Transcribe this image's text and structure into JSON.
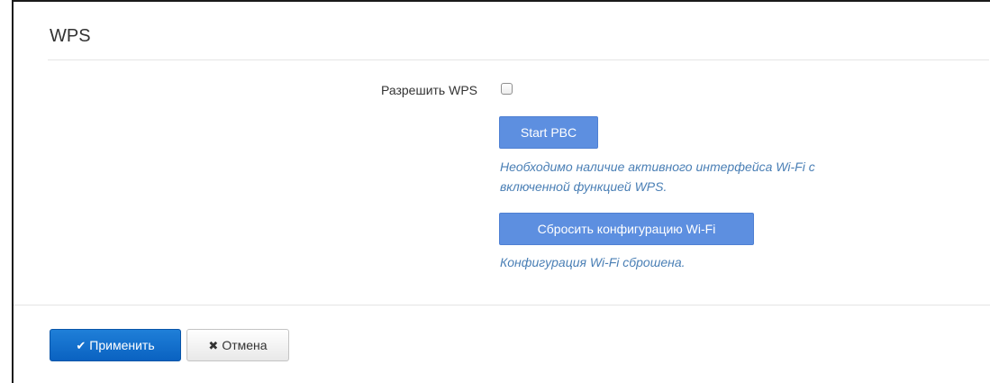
{
  "section": {
    "title": "WPS"
  },
  "wps_enable": {
    "label": "Разрешить WPS",
    "checked": false
  },
  "pbc": {
    "button_label": "Start PBC",
    "help_line1": "Необходимо наличие активного интерфейса Wi-Fi с",
    "help_line2": "включенной функцией WPS."
  },
  "reset": {
    "button_label": "Сбросить конфигурацию Wi-Fi",
    "status": "Конфигурация Wi-Fi сброшена."
  },
  "footer": {
    "apply_label": "Применить",
    "apply_icon": "check-icon",
    "cancel_label": "Отмена",
    "cancel_icon": "times-icon"
  },
  "colors": {
    "primary": "#0a62c1",
    "button_light": "#5d8fe0",
    "help_text": "#4a7fb5"
  }
}
